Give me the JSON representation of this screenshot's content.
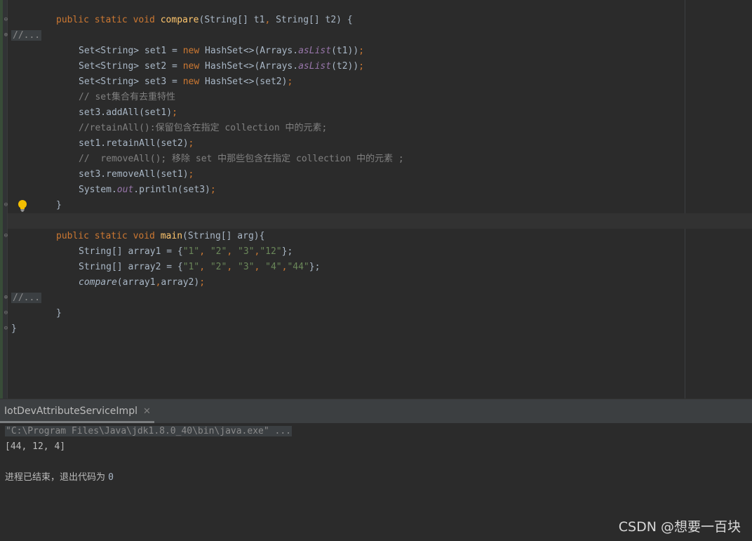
{
  "editor": {
    "folded_placeholder": "//...",
    "compare_sig": {
      "mods": "public static void ",
      "name": "compare",
      "params": "(String[] t1",
      "comma": ", ",
      "params2": "String[] t2) {"
    },
    "set1_line": {
      "pre": "Set<String> set1 = ",
      "new": "new",
      "post": " HashSet<>(Arrays.",
      "method": "asList",
      "args": "(t1))",
      "semi": ";"
    },
    "set2_line": {
      "pre": "Set<String> set2 = ",
      "new": "new",
      "post": " HashSet<>(Arrays.",
      "method": "asList",
      "args": "(t2))",
      "semi": ";"
    },
    "set3_line": {
      "pre": "Set<String> set3 = ",
      "new": "new",
      "post": " HashSet<>(set2)",
      "semi": ";"
    },
    "comment1": "// set集合有去重特性",
    "addall_line": {
      "code": "set3.addAll(set1)",
      "semi": ";"
    },
    "comment2": "//retainAll():保留包含在指定 collection 中的元素;",
    "retain_line": {
      "code": "set1.retainAll(set2)",
      "semi": ";"
    },
    "comment3": "//  removeAll(); 移除 set 中那些包含在指定 collection 中的元素 ;",
    "remove_line": {
      "code": "set3.removeAll(set1)",
      "semi": ";"
    },
    "print_line": {
      "pre": "System.",
      "field": "out",
      "post": ".println(set3)",
      "semi": ";"
    },
    "close_brace": "}",
    "main_sig": {
      "mods": "public static void ",
      "name": "main",
      "params": "(String[] arg){"
    },
    "array1_line": {
      "pre": "String[] array1 = {",
      "s1": "\"1\"",
      "c1": ", ",
      "s2": "\"2\"",
      "c2": ", ",
      "s3": "\"3\"",
      "c3": ",",
      "s4": "\"12\"",
      "post": "};"
    },
    "array2_line": {
      "pre": "String[] array2 = {",
      "s1": "\"1\"",
      "c1": ", ",
      "s2": "\"2\"",
      "c2": ", ",
      "s3": "\"3\"",
      "c3": ", ",
      "s4": "\"4\"",
      "c4": ",",
      "s5": "\"44\"",
      "post": "};"
    },
    "call_line": {
      "method": "compare",
      "args": "(array1",
      "comma": ",",
      "args2": "array2)",
      "semi": ";"
    },
    "class_close": "}"
  },
  "run_panel": {
    "tab_label": "IotDevAttributeServiceImpl",
    "tab_close_glyph": "✕",
    "cmd": "\"C:\\Program Files\\Java\\jdk1.8.0_40\\bin\\java.exe\" ...",
    "output": "[44, 12, 4]",
    "exit_text": "进程已结束，退出代码为 ",
    "exit_code": "0"
  },
  "watermark": "CSDN @想要一百块",
  "icons": {
    "bulb": "lightbulb-icon",
    "fold": "fold-marker-icon"
  },
  "colors": {
    "keyword": "#cc7832",
    "function": "#ffc66d",
    "string": "#6a8759",
    "comment": "#808080",
    "field": "#9876aa"
  }
}
